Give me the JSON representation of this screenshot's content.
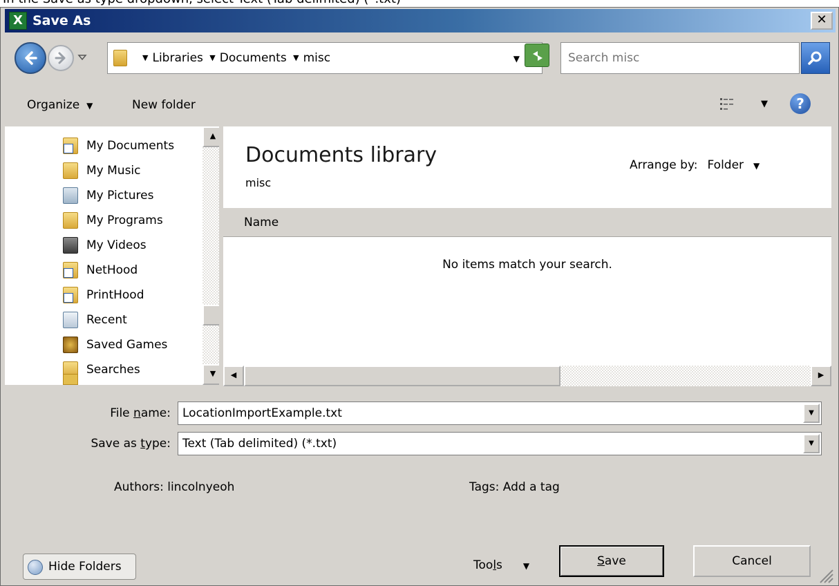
{
  "instruction": {
    "text": "In the Save as type dropdown, select Text (Tab delimited) (*.txt)"
  },
  "window": {
    "title": "Save As",
    "close_label": "✕"
  },
  "address_bar": {
    "crumbs": [
      "Libraries",
      "Documents",
      "misc"
    ]
  },
  "search": {
    "placeholder": "Search misc"
  },
  "toolbar": {
    "organize_label": "Organize",
    "new_folder_label": "New folder"
  },
  "nav": {
    "items": [
      {
        "label": "My Documents",
        "icon": "shortcut-folder-icon"
      },
      {
        "label": "My Music",
        "icon": "music-folder-icon"
      },
      {
        "label": "My Pictures",
        "icon": "pictures-folder-icon"
      },
      {
        "label": "My Programs",
        "icon": "folder-icon"
      },
      {
        "label": "My Videos",
        "icon": "videos-folder-icon"
      },
      {
        "label": "NetHood",
        "icon": "shortcut-folder-icon"
      },
      {
        "label": "PrintHood",
        "icon": "shortcut-folder-icon"
      },
      {
        "label": "Recent",
        "icon": "recent-icon"
      },
      {
        "label": "Saved Games",
        "icon": "saved-games-icon"
      },
      {
        "label": "Searches",
        "icon": "searches-folder-icon"
      }
    ]
  },
  "content": {
    "library_title": "Documents library",
    "library_subtitle": "misc",
    "arrange_label": "Arrange by:",
    "arrange_value": "Folder",
    "column_name": "Name",
    "empty_message": "No items match your search."
  },
  "fields": {
    "filename_label_pre": "File ",
    "filename_label_u": "n",
    "filename_label_post": "ame:",
    "filename_value": "LocationImportExample.txt",
    "type_label_pre": "Save as ",
    "type_label_u": "t",
    "type_label_post": "ype:",
    "type_value": "Text (Tab delimited) (*.txt)"
  },
  "meta": {
    "authors_label": "Authors:",
    "authors_value": "lincolnyeoh",
    "tags_label": "Tags:",
    "tags_value": "Add a tag"
  },
  "buttons": {
    "hide_folders": "Hide Folders",
    "tools_pre": "Too",
    "tools_u": "l",
    "tools_post": "s",
    "save_u": "S",
    "save_post": "ave",
    "cancel": "Cancel"
  },
  "colors": {
    "dialog_bg": "#d6d3ce",
    "titlebar_start": "#0a246a",
    "titlebar_end": "#a6caf0"
  }
}
